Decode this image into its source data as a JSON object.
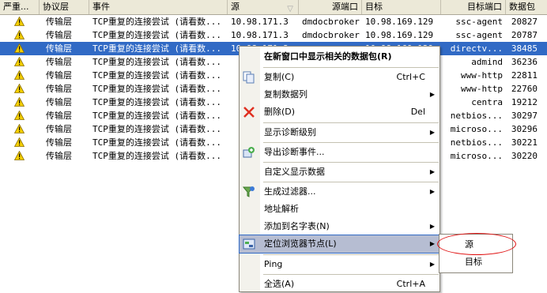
{
  "columns": [
    "严重...",
    "协议层",
    "事件",
    "源",
    "源端口",
    "目标",
    "目标端口",
    "数据包"
  ],
  "rows": [
    {
      "layer": "传输层",
      "event": "TCP重复的连接尝试 (请看数...",
      "src": "10.98.171.3",
      "sport": "dmdocbroker",
      "dst": "10.98.169.129",
      "dport": "ssc-agent",
      "pkts": "20827"
    },
    {
      "layer": "传输层",
      "event": "TCP重复的连接尝试 (请看数...",
      "src": "10.98.171.3",
      "sport": "dmdocbroker",
      "dst": "10.98.169.129",
      "dport": "ssc-agent",
      "pkts": "20787"
    },
    {
      "layer": "传输层",
      "event": "TCP重复的连接尝试 (请看数...",
      "src": "10.98.171.3",
      "sport": "",
      "dst": "10.98.169.129",
      "dport": "directv...",
      "pkts": "38485"
    },
    {
      "layer": "传输层",
      "event": "TCP重复的连接尝试 (请看数...",
      "src": "",
      "sport": "",
      "dst": "",
      "dport": "admind",
      "pkts": "36236"
    },
    {
      "layer": "传输层",
      "event": "TCP重复的连接尝试 (请看数...",
      "src": "",
      "sport": "",
      "dst": "",
      "dport": "www-http",
      "pkts": "22811"
    },
    {
      "layer": "传输层",
      "event": "TCP重复的连接尝试 (请看数...",
      "src": "",
      "sport": "",
      "dst": "",
      "dport": "www-http",
      "pkts": "22760"
    },
    {
      "layer": "传输层",
      "event": "TCP重复的连接尝试 (请看数...",
      "src": "",
      "sport": "",
      "dst": "",
      "dport": "centra",
      "pkts": "19212"
    },
    {
      "layer": "传输层",
      "event": "TCP重复的连接尝试 (请看数...",
      "src": "",
      "sport": "",
      "dst": "",
      "dport": "netbios...",
      "pkts": "30297"
    },
    {
      "layer": "传输层",
      "event": "TCP重复的连接尝试 (请看数...",
      "src": "",
      "sport": "",
      "dst": "",
      "dport": "microso...",
      "pkts": "30296"
    },
    {
      "layer": "传输层",
      "event": "TCP重复的连接尝试 (请看数...",
      "src": "",
      "sport": "",
      "dst": "",
      "dport": "netbios...",
      "pkts": "30221"
    },
    {
      "layer": "传输层",
      "event": "TCP重复的连接尝试 (请看数...",
      "src": "",
      "sport": "",
      "dst": "",
      "dport": "microso...",
      "pkts": "30220"
    }
  ],
  "menu": {
    "open_new_window": "在新窗口中显示相关的数据包(R)",
    "copy": "复制(C)",
    "copy_shortcut": "Ctrl+C",
    "copy_columns": "复制数据列",
    "delete": "删除(D)",
    "delete_shortcut": "Del",
    "diag_level": "显示诊断级别",
    "export_diag": "导出诊断事件...",
    "custom_display": "自定义显示数据",
    "make_filter": "生成过滤器...",
    "resolve": "地址解析",
    "add_names": "添加到名字表(N)",
    "locate_node": "定位浏览器节点(L)",
    "ping": "Ping",
    "select_all": "全选(A)",
    "select_all_shortcut": "Ctrl+A"
  },
  "submenu": {
    "source": "源",
    "target": "目标"
  }
}
